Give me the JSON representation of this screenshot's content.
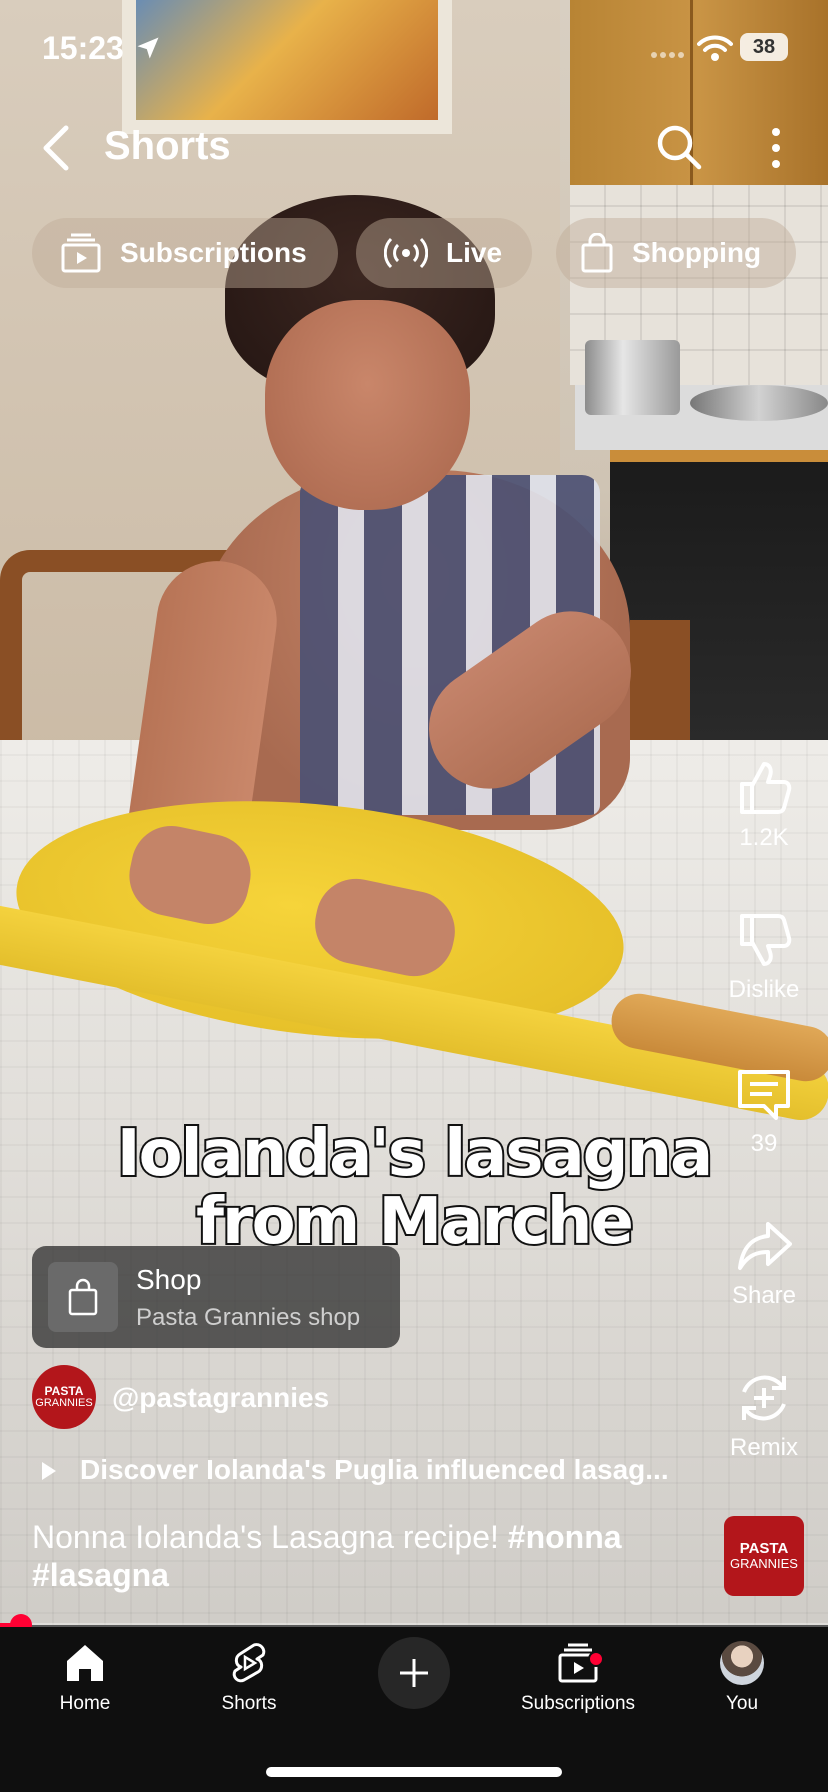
{
  "status_bar": {
    "time": "15:23",
    "battery": "38"
  },
  "header": {
    "title": "Shorts"
  },
  "chips": [
    {
      "label": "Subscriptions"
    },
    {
      "label": "Live"
    },
    {
      "label": "Shopping"
    }
  ],
  "video_overlay_text": {
    "line1": "Iolanda's lasagna",
    "line2": "from Marche"
  },
  "actions": {
    "like_count": "1.2K",
    "dislike_label": "Dislike",
    "comment_count": "39",
    "share_label": "Share",
    "remix_label": "Remix"
  },
  "shop_card": {
    "title": "Shop",
    "subtitle": "Pasta Grannies shop"
  },
  "channel": {
    "handle": "@pastagrannies",
    "avatar_text_top": "PASTA",
    "avatar_text_bottom": "GRANNIES"
  },
  "description_link": "Discover Iolanda's Puglia influenced lasag...",
  "video_title": {
    "text": "Nonna Iolanda's Lasagna recipe! ",
    "tag1": "#nonna",
    "tag2": "#lasagna"
  },
  "music_thumb": {
    "text_top": "PASTA",
    "text_bottom": "GRANNIES"
  },
  "progress": {
    "fraction": 0.025
  },
  "nav": {
    "home": "Home",
    "shorts": "Shorts",
    "subscriptions": "Subscriptions",
    "you": "You"
  },
  "colors": {
    "accent": "#ff0033",
    "nav_bg": "#0f0f0f",
    "brand_red": "#b3161b"
  }
}
